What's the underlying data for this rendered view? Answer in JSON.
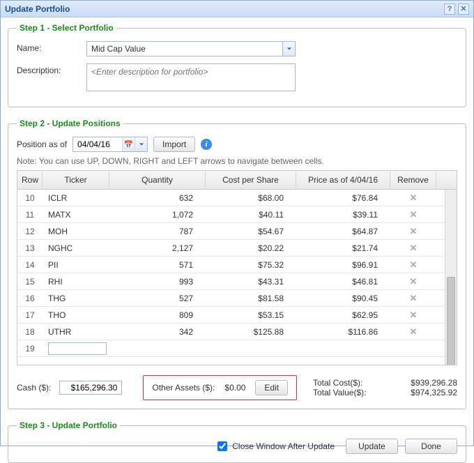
{
  "window": {
    "title": "Update Portfolio"
  },
  "step1": {
    "legend": "Step 1 - Select Portfolio",
    "name_label": "Name:",
    "name_value": "Mid Cap Value",
    "description_label": "Description:",
    "description_placeholder": "<Enter description for portfolio>"
  },
  "step2": {
    "legend": "Step 2 - Update Positions",
    "position_label": "Position as of",
    "position_date": "04/04/16",
    "import_label": "Import",
    "note": "Note: You can use UP, DOWN, RIGHT and LEFT arrows to navigate between cells.",
    "columns": {
      "row": "Row",
      "ticker": "Ticker",
      "quantity": "Quantity",
      "cost": "Cost per Share",
      "price": "Price as of 4/04/16",
      "remove": "Remove"
    },
    "rows": [
      {
        "n": "10",
        "ticker": "ICLR",
        "qty": "632",
        "cost": "$68.00",
        "price": "$76.84"
      },
      {
        "n": "11",
        "ticker": "MATX",
        "qty": "1,072",
        "cost": "$40.11",
        "price": "$39.11"
      },
      {
        "n": "12",
        "ticker": "MOH",
        "qty": "787",
        "cost": "$54.67",
        "price": "$64.87"
      },
      {
        "n": "13",
        "ticker": "NGHC",
        "qty": "2,127",
        "cost": "$20.22",
        "price": "$21.74"
      },
      {
        "n": "14",
        "ticker": "PII",
        "qty": "571",
        "cost": "$75.32",
        "price": "$96.91"
      },
      {
        "n": "15",
        "ticker": "RHI",
        "qty": "993",
        "cost": "$43.31",
        "price": "$46.81"
      },
      {
        "n": "16",
        "ticker": "THG",
        "qty": "527",
        "cost": "$81.58",
        "price": "$90.45"
      },
      {
        "n": "17",
        "ticker": "THO",
        "qty": "809",
        "cost": "$53.15",
        "price": "$62.95"
      },
      {
        "n": "18",
        "ticker": "UTHR",
        "qty": "342",
        "cost": "$125.88",
        "price": "$116.86"
      }
    ],
    "empty_row_n": "19",
    "cash_label": "Cash ($):",
    "cash_value": "$165,296.30",
    "other_label": "Other Assets ($):",
    "other_value": "$0.00",
    "edit_label": "Edit",
    "total_cost_label": "Total Cost($):",
    "total_cost_value": "$939,296.28",
    "total_value_label": "Total Value($):",
    "total_value_value": "$974,325.92"
  },
  "step3": {
    "legend": "Step 3 - Update Portfolio",
    "close_label": "Close Window After Update",
    "update_label": "Update",
    "done_label": "Done"
  }
}
